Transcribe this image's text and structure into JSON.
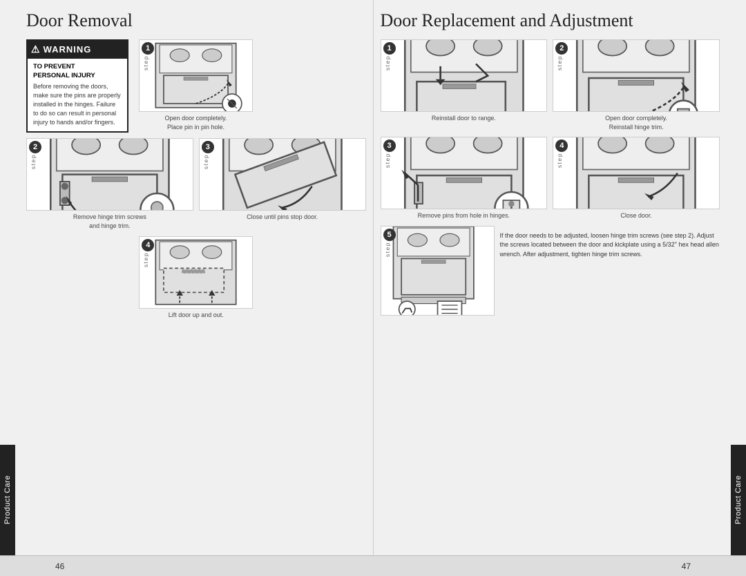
{
  "left_title": "Door Removal",
  "right_title": "Door Replacement and Adjustment",
  "warning": {
    "header": "WARNING",
    "subheader": "TO PREVENT\nPERSONAL INJURY",
    "text": "Before removing the doors, make sure the pins are properly installed in the hinges. Failure to do so can result in personal injury to hands and/or fingers."
  },
  "left_steps": [
    {
      "number": "1",
      "caption": "Open door completely.\nPlace pin in pin hole."
    },
    {
      "number": "2",
      "caption": "Remove hinge trim screws\nand hinge trim."
    },
    {
      "number": "3",
      "caption": "Close until pins stop door."
    },
    {
      "number": "4",
      "caption": "Lift door up and out."
    }
  ],
  "right_steps": [
    {
      "number": "1",
      "caption": "Reinstall door to range."
    },
    {
      "number": "2",
      "caption": "Open door completely.\nReinstall hinge trim."
    },
    {
      "number": "3",
      "caption": "Remove pins from hole in hinges."
    },
    {
      "number": "4",
      "caption": "Close door."
    },
    {
      "number": "5",
      "caption": "If the door needs to be adjusted, loosen hinge trim screws (see step 2). Adjust the screws located between the door and kickplate using a 5/32\" hex head allen wrench. After adjustment, tighten hinge trim screws."
    }
  ],
  "footer": {
    "left_page": "46",
    "right_page": "47"
  },
  "side_tab_label": "Product Care",
  "step_vertical_label": "step"
}
